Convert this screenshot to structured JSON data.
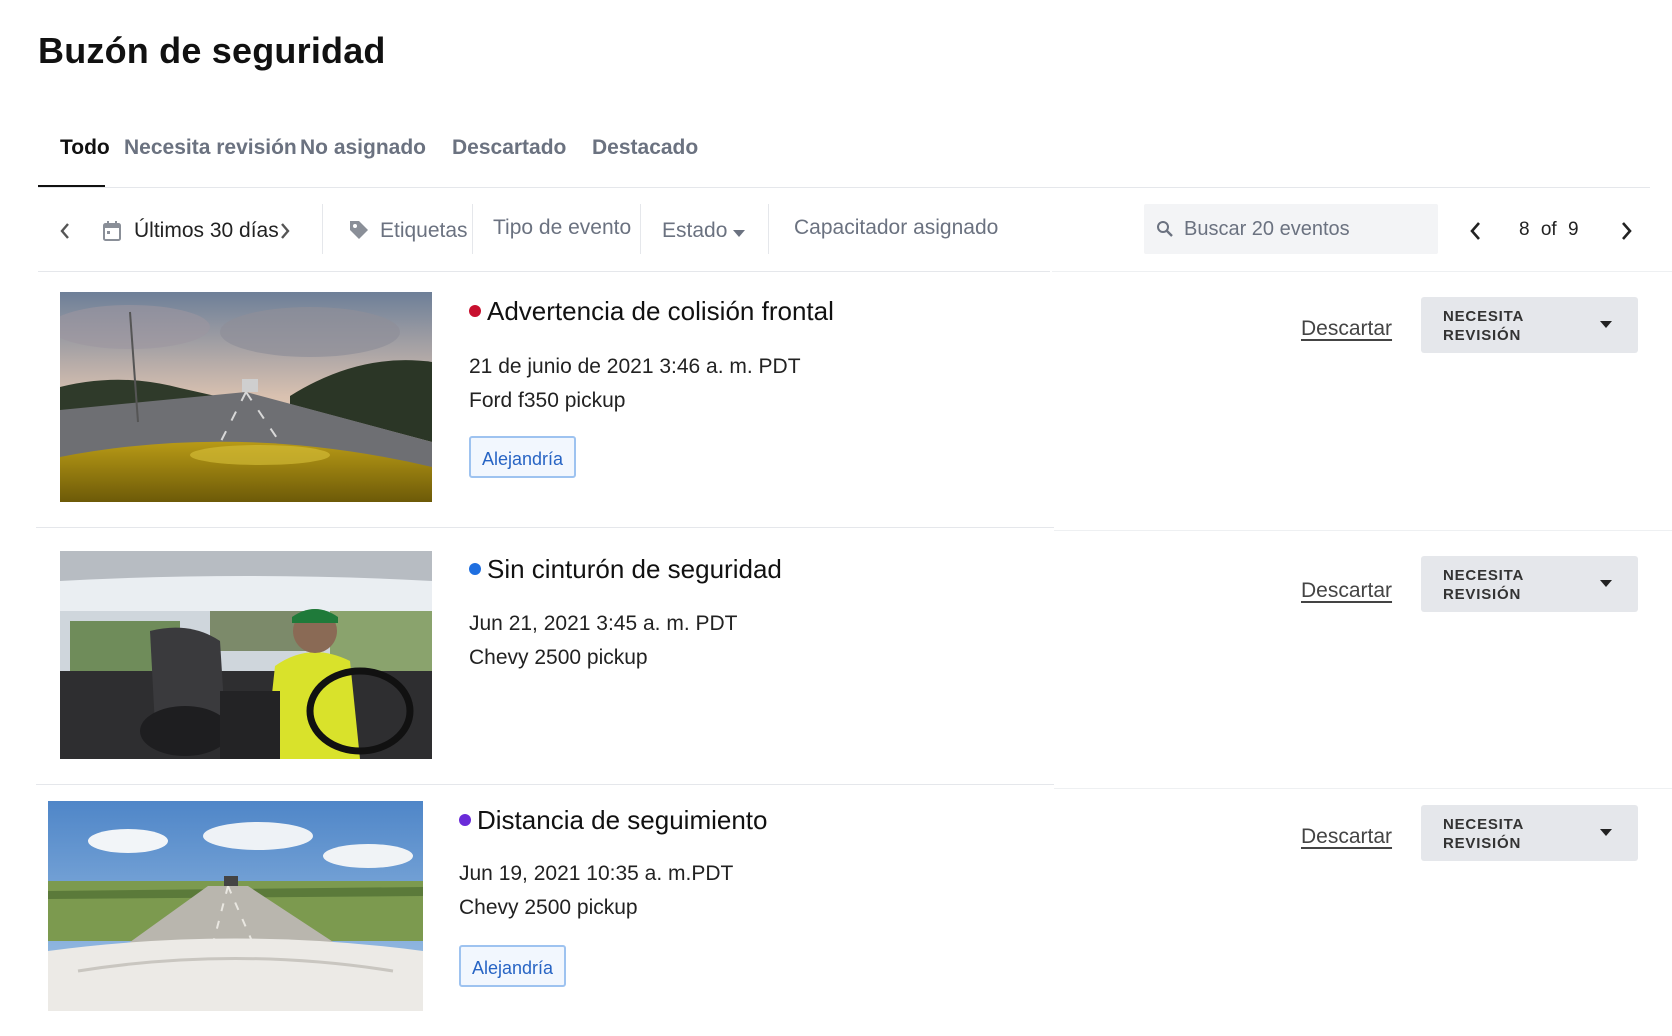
{
  "page": {
    "title": "Buzón de seguridad"
  },
  "tabs": [
    {
      "label": "Todo",
      "active": true
    },
    {
      "label": "Necesita revisión",
      "active": false
    },
    {
      "label": "No asignado",
      "active": false
    },
    {
      "label": "Descartado",
      "active": false
    },
    {
      "label": "Destacado",
      "active": false
    }
  ],
  "toolbar": {
    "date_range": "Últimos 30 días",
    "tags_label": "Etiquetas",
    "event_type_label": "Tipo de evento",
    "status_label": "Estado",
    "coach_label": "Capacitador asignado",
    "search_placeholder": "Buscar 20 eventos",
    "pagination": {
      "current": "8",
      "of": "of",
      "total": "9"
    }
  },
  "events": [
    {
      "title": "Advertencia de colisión frontal",
      "dot_color": "#c8102e",
      "datetime": "21 de junio de 2021 3:46 a. m. PDT",
      "vehicle": "Ford f350 pickup",
      "tag": "Alejandría",
      "dismiss_label": "Descartar",
      "status_line1": "NECESITA",
      "status_line2": "REVISIÓN"
    },
    {
      "title": "Sin cinturón de seguridad",
      "dot_color": "#1f6fe0",
      "datetime": "Jun 21, 2021 3:45 a. m. PDT",
      "vehicle": "Chevy 2500 pickup",
      "dismiss_label": "Descartar",
      "status_line1": "NECESITA",
      "status_line2": "REVISIÓN"
    },
    {
      "title": "Distancia de seguimiento",
      "dot_color": "#6a2bd9",
      "datetime": "Jun 19, 2021 10:35 a. m.PDT",
      "vehicle": "Chevy 2500 pickup",
      "tag": "Alejandría",
      "dismiss_label": "Descartar",
      "status_line1": "NECESITA",
      "status_line2": "REVISIÓN"
    }
  ]
}
